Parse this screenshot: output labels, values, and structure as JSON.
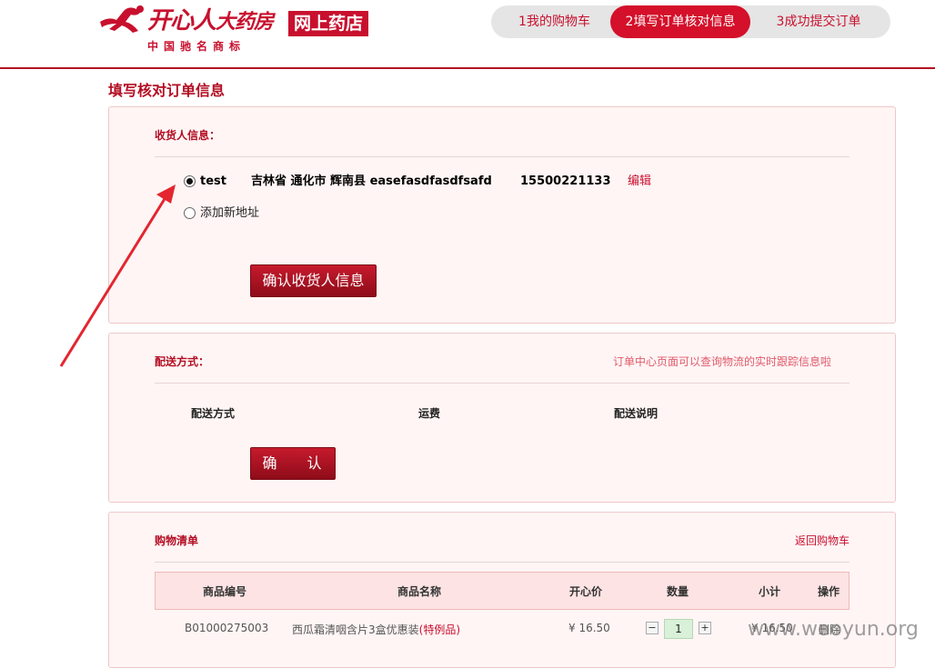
{
  "header": {
    "logo_name": "开心人",
    "logo_name_suffix": "大药房",
    "logo_badge": "网上药店",
    "logo_sub": "中国驰名商标",
    "steps": [
      {
        "label": "1我的购物车"
      },
      {
        "label": "2填写订单核对信息"
      },
      {
        "label": "3成功提交订单"
      }
    ]
  },
  "page_title": "填写核对订单信息",
  "consignee": {
    "title": "收货人信息：",
    "address": {
      "name": "test",
      "detail": "吉林省 通化市 辉南县 easefasdfasdfsafd",
      "phone": "15500221133",
      "edit_label": "编辑"
    },
    "add_new_label": "添加新地址",
    "confirm_label": "确认收货人信息"
  },
  "delivery": {
    "title": "配送方式：",
    "tip": "订单中心页面可以查询物流的实时跟踪信息啦",
    "columns": [
      "配送方式",
      "运费",
      "配送说明"
    ],
    "confirm_label": "确 认"
  },
  "cart": {
    "title": "购物清单",
    "back_label": "返回购物车",
    "columns": [
      "商品编号",
      "商品名称",
      "开心价",
      "数量",
      "小计",
      "操作"
    ],
    "rows": [
      {
        "code": "B01000275003",
        "name": "西瓜霜清咽含片3盒优惠装",
        "tag": "(特例品)",
        "price": "¥ 16.50",
        "qty": "1",
        "subtotal": "¥ 16.50",
        "action": "删除"
      }
    ]
  },
  "watermark": "www.wooyun.org",
  "colors": {
    "brand": "#c8102e",
    "panel_bg": "#fff5f5"
  }
}
